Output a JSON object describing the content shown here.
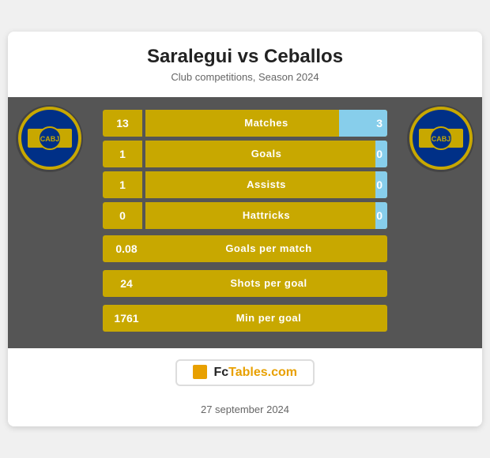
{
  "header": {
    "title": "Saralegui vs Ceballos",
    "subtitle": "Club competitions, Season 2024"
  },
  "stats": {
    "with_right": [
      {
        "label": "Matches",
        "left_val": "13",
        "right_val": "3",
        "fill_pct": 20
      },
      {
        "label": "Goals",
        "left_val": "1",
        "right_val": "0",
        "fill_pct": 5
      },
      {
        "label": "Assists",
        "left_val": "1",
        "right_val": "0",
        "fill_pct": 5
      },
      {
        "label": "Hattricks",
        "left_val": "0",
        "right_val": "0",
        "fill_pct": 5
      }
    ],
    "full_width": [
      {
        "label": "Goals per match",
        "left_val": "0.08"
      },
      {
        "label": "Shots per goal",
        "left_val": "24"
      },
      {
        "label": "Min per goal",
        "left_val": "1761"
      }
    ]
  },
  "watermark": {
    "icon": "chart-icon",
    "text_plain": "Fc",
    "text_accent": "Tables.com"
  },
  "footer": {
    "date": "27 september 2024"
  }
}
